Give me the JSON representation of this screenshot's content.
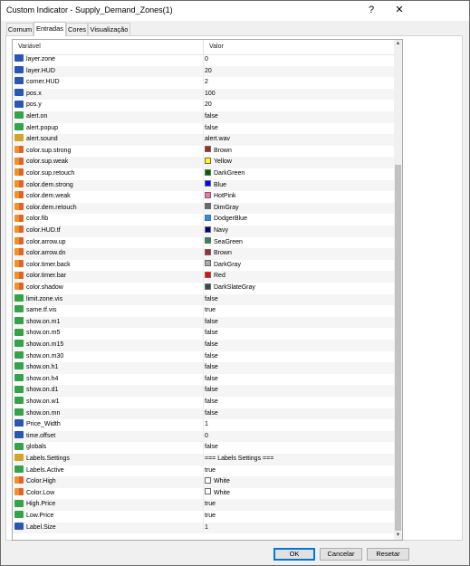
{
  "window": {
    "title": "Custom Indicator - Supply_Demand_Zones(1)",
    "help_label": "?",
    "close_label": "✕"
  },
  "tabs": [
    {
      "label": "Comum"
    },
    {
      "label": "Entradas"
    },
    {
      "label": "Cores"
    },
    {
      "label": "Visualização"
    }
  ],
  "active_tab": "Entradas",
  "grid": {
    "col_variable": "Variável",
    "col_value": "Valor"
  },
  "rows": [
    {
      "name": "layer.zone",
      "value": "0",
      "type": "num"
    },
    {
      "name": "layer.HUD",
      "value": "20",
      "type": "num"
    },
    {
      "name": "corner.HUD",
      "value": "2",
      "type": "num"
    },
    {
      "name": "pos.x",
      "value": "100",
      "type": "num"
    },
    {
      "name": "pos.y",
      "value": "20",
      "type": "num"
    },
    {
      "name": "alert.on",
      "value": "false",
      "type": "bool"
    },
    {
      "name": "alert.popup",
      "value": "false",
      "type": "bool"
    },
    {
      "name": "alert.sound",
      "value": "alert.wav",
      "type": "str"
    },
    {
      "name": "color.sup.strong",
      "value": "Brown",
      "type": "col",
      "color": "#a52a2a"
    },
    {
      "name": "color.sup.weak",
      "value": "Yellow",
      "type": "col",
      "color": "#ffff00"
    },
    {
      "name": "color.sup.retouch",
      "value": "DarkGreen",
      "type": "col",
      "color": "#006400"
    },
    {
      "name": "color.dem.strong",
      "value": "Blue",
      "type": "col",
      "color": "#0000ff"
    },
    {
      "name": "color.dem.weak",
      "value": "HotPink",
      "type": "col",
      "color": "#ff69b4"
    },
    {
      "name": "color.dem.retouch",
      "value": "DimGray",
      "type": "col",
      "color": "#696969"
    },
    {
      "name": "color.fib",
      "value": "DodgerBlue",
      "type": "col",
      "color": "#1e90ff"
    },
    {
      "name": "color.HUD.tf",
      "value": "Navy",
      "type": "col",
      "color": "#000080"
    },
    {
      "name": "color.arrow.up",
      "value": "SeaGreen",
      "type": "col",
      "color": "#2e8b57"
    },
    {
      "name": "color.arrow.dn",
      "value": "Brown",
      "type": "col",
      "color": "#a52a2a"
    },
    {
      "name": "color.timer.back",
      "value": "DarkGray",
      "type": "col",
      "color": "#a9a9a9"
    },
    {
      "name": "color.timer.bar",
      "value": "Red",
      "type": "col",
      "color": "#ff0000"
    },
    {
      "name": "color.shadow",
      "value": "DarkSlateGray",
      "type": "col",
      "color": "#2f4f4f"
    },
    {
      "name": "limit.zone.vis",
      "value": "false",
      "type": "bool"
    },
    {
      "name": "same.tf.vis",
      "value": "true",
      "type": "bool"
    },
    {
      "name": "show.on.m1",
      "value": "false",
      "type": "bool"
    },
    {
      "name": "show.on.m5",
      "value": "false",
      "type": "bool"
    },
    {
      "name": "show.on.m15",
      "value": "false",
      "type": "bool"
    },
    {
      "name": "show.on.m30",
      "value": "false",
      "type": "bool"
    },
    {
      "name": "show.on.h1",
      "value": "false",
      "type": "bool"
    },
    {
      "name": "show.on.h4",
      "value": "false",
      "type": "bool"
    },
    {
      "name": "show.on.d1",
      "value": "false",
      "type": "bool"
    },
    {
      "name": "show.on.w1",
      "value": "false",
      "type": "bool"
    },
    {
      "name": "show.on.mn",
      "value": "false",
      "type": "bool"
    },
    {
      "name": "Price_Width",
      "value": "1",
      "type": "num"
    },
    {
      "name": "time.offset",
      "value": "0",
      "type": "num"
    },
    {
      "name": "globals",
      "value": "false",
      "type": "bool"
    },
    {
      "name": "Labels.Settings",
      "value": "=== Labels Settings ===",
      "type": "str"
    },
    {
      "name": "Labels.Active",
      "value": "true",
      "type": "bool"
    },
    {
      "name": "Color.High",
      "value": "White",
      "type": "col",
      "color": "#ffffff"
    },
    {
      "name": "Color.Low",
      "value": "White",
      "type": "col",
      "color": "#ffffff"
    },
    {
      "name": "High.Price",
      "value": "true",
      "type": "bool"
    },
    {
      "name": "Low.Price",
      "value": "true",
      "type": "bool"
    },
    {
      "name": "Label.Size",
      "value": "1",
      "type": "num"
    }
  ],
  "scrollbar": {
    "up_icon": "▲",
    "down_icon": "▼"
  },
  "buttons": {
    "ok": "OK",
    "cancel": "Cancelar",
    "reset": "Resetar"
  }
}
